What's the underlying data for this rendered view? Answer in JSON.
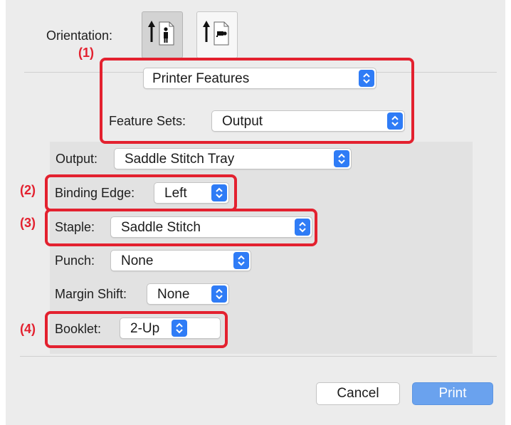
{
  "orientation": {
    "label": "Orientation:",
    "options": [
      "portrait-icon",
      "landscape-icon"
    ],
    "selected": "portrait-icon"
  },
  "section_select": {
    "value": "Printer Features"
  },
  "feature_sets": {
    "label": "Feature Sets:",
    "value": "Output"
  },
  "output": {
    "label": "Output:",
    "value": "Saddle Stitch Tray"
  },
  "binding_edge": {
    "label": "Binding Edge:",
    "value": "Left"
  },
  "staple": {
    "label": "Staple:",
    "value": "Saddle Stitch"
  },
  "punch": {
    "label": "Punch:",
    "value": "None"
  },
  "margin_shift": {
    "label": "Margin Shift:",
    "value": "None"
  },
  "booklet": {
    "label": "Booklet:",
    "value": "2-Up"
  },
  "callouts": {
    "c1": "(1)",
    "c2": "(2)",
    "c3": "(3)",
    "c4": "(4)"
  },
  "buttons": {
    "cancel": "Cancel",
    "print": "Print"
  },
  "colors": {
    "accent": "#2f7cf6",
    "callout": "#e3212f",
    "print_button": "#6aa2ee"
  }
}
